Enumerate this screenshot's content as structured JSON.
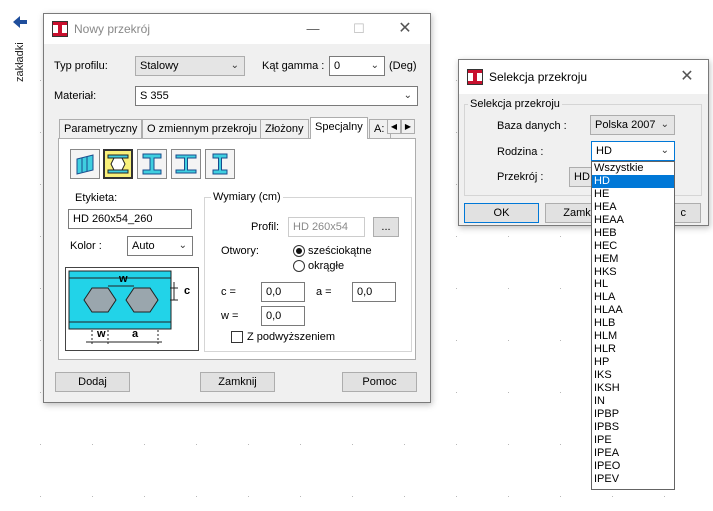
{
  "side": {
    "back_icon": "arrow-left-icon",
    "tab_label": "zakładki"
  },
  "main_dialog": {
    "title": "Nowy przekrój",
    "app_icon": "section-i-beam-icon",
    "profile_type_label": "Typ profilu:",
    "profile_type_value": "Stalowy",
    "gamma_label": "Kąt gamma :",
    "gamma_value": "0",
    "gamma_unit": "(Deg)",
    "material_label": "Materiał:",
    "material_value": "S 355",
    "tabs": [
      {
        "label": "Parametryczny"
      },
      {
        "label": "O zmiennym przekroju"
      },
      {
        "label": "Złożony"
      },
      {
        "label": "Specjalny"
      },
      {
        "label": "A:"
      }
    ],
    "active_tab": "Specjalny",
    "section_types": [
      "cold-formed-icon",
      "castellated-beam-icon",
      "i-beam-icon",
      "i-beam-wide-icon",
      "i-beam-narrow-icon"
    ],
    "label_caption": "Etykieta:",
    "label_value": "HD 260x54_260",
    "color_label": "Kolor :",
    "color_value": "Auto",
    "dims_group": "Wymiary (cm)",
    "profile_label": "Profil:",
    "profile_value": "HD 260x54",
    "browse_label": "...",
    "holes_label": "Otwory:",
    "hole_hex": "sześciokątne",
    "hole_round": "okrągłe",
    "c_label": "c =",
    "c_value": "0,0",
    "a_label": "a =",
    "a_value": "0,0",
    "w_label": "w =",
    "w_value": "0,0",
    "raised_label": "Z podwyższeniem",
    "diagram_labels": {
      "w_top": "w",
      "c": "c",
      "w_bottom": "w",
      "a": "a"
    },
    "add_button": "Dodaj",
    "close_button": "Zamknij",
    "help_button": "Pomoc"
  },
  "selection_dialog": {
    "title": "Selekcja przekroju",
    "group_label": "Selekcja przekroju",
    "database_label": "Baza danych :",
    "database_value": "Polska 2007",
    "family_label": "Rodzina :",
    "family_value": "HD",
    "section_label": "Przekrój :",
    "section_value": "HD",
    "ok_button": "OK",
    "close_button": "Zamknij",
    "help_button_partial": "c"
  },
  "family_dropdown": {
    "options": [
      "Wszystkie",
      "HD",
      "HE",
      "HEA",
      "HEAA",
      "HEB",
      "HEC",
      "HEM",
      "HKS",
      "HL",
      "HLA",
      "HLAA",
      "HLB",
      "HLM",
      "HLR",
      "HP",
      "IKS",
      "IKSH",
      "IN",
      "IPBP",
      "IPBS",
      "IPE",
      "IPEA",
      "IPEO",
      "IPEV"
    ],
    "selected": "HD"
  },
  "colors": {
    "accent": "#0078d7",
    "diagram_fill": "#22d3e8",
    "selected_type": "#f8f07a",
    "icon_cyan": "#3fcfe0",
    "icon_red": "#c8102e"
  }
}
